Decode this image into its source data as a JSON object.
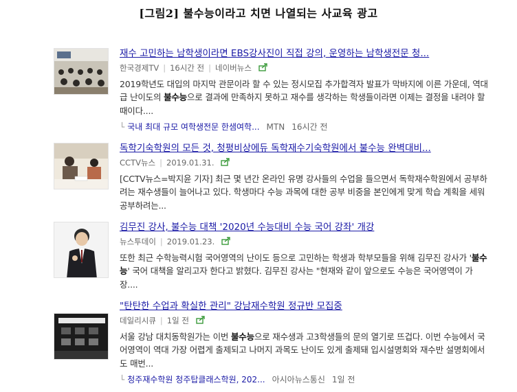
{
  "caption": "[그림2] 불수능이라고 치면 나열되는 사교육 광고",
  "items": [
    {
      "title": "재수 고민하는 남학생이라면 EBS강사진이 직접 강의, 운영하는 남학생전문 청...",
      "source": "한국경제TV",
      "time": "16시간 전",
      "extra": "네이버뉴스",
      "desc_a": "2019학년도 대입의 마지막 관문이라 할 수 있는 정시모집 추가합격자 발표가 막바지에 이른 가운데, 역대급 난이도의 ",
      "desc_b": "불수능",
      "desc_c": "으로 결과에 만족하지 못하고 재수를 생각하는 학생들이라면 이제는 결정을 내려야 할 때이다....",
      "related_title": "국내 최대 규모 여학생전문 한샘여학...",
      "related_source": "MTN",
      "related_time": "16시간 전"
    },
    {
      "title": "독학기숙학원의 모든 것, 청평비상에듀 독학재수기숙학원에서 불수능 완벽대비...",
      "source": "CCTV뉴스",
      "time": "2019.01.31.",
      "desc_a": "[CCTV뉴스=박지윤 기자] 최근 몇 년간 온라인 유명 강사들의 수업을 들으면서 독학재수학원에서 공부하려는 재수생들이 늘어나고 있다. 학생마다 수능 과목에 대한 공부 비중을 본인에게 맞게 학습 계획을 세워 공부하려는...",
      "desc_b": "",
      "desc_c": ""
    },
    {
      "title": "김무진 강사, 불수능 대책 '2020년 수능대비 수능 국어 강좌' 개강",
      "source": "뉴스투데이",
      "time": "2019.01.23.",
      "desc_a": "또한 최근 수학능력시험 국어영역의 난이도 등으로 고민하는 학생과 학부모들을 위해 김무진 강사가 '",
      "desc_b": "불수능",
      "desc_c": "' 국어 대책을 알리고자 한다고 밝혔다. 김무진 강사는 \"현재와 같이 앞으로도 수능은 국어영역이 가장...."
    },
    {
      "title": "\"탄탄한 수업과 확실한 관리\" 강남재수학원 정규반 모집중",
      "source": "데일리시큐",
      "time": "1일 전",
      "desc_a": "서울 강남 대치동학원가는 이번 ",
      "desc_b": "불수능",
      "desc_c": "으로 재수생과 고3학생들의 문의 열기로 뜨겁다. 이번 수능에서 국어영역이 역대 가장 어렵게 출제되고 나머지 과목도 난이도 있게 출제돼 입시설명회와 재수반 설명회에서도 매번...",
      "related_title": "청주재수학원 청주탑클래스학원, 202...",
      "related_source": "아시아뉴스통신",
      "related_time": "1일 전"
    }
  ]
}
